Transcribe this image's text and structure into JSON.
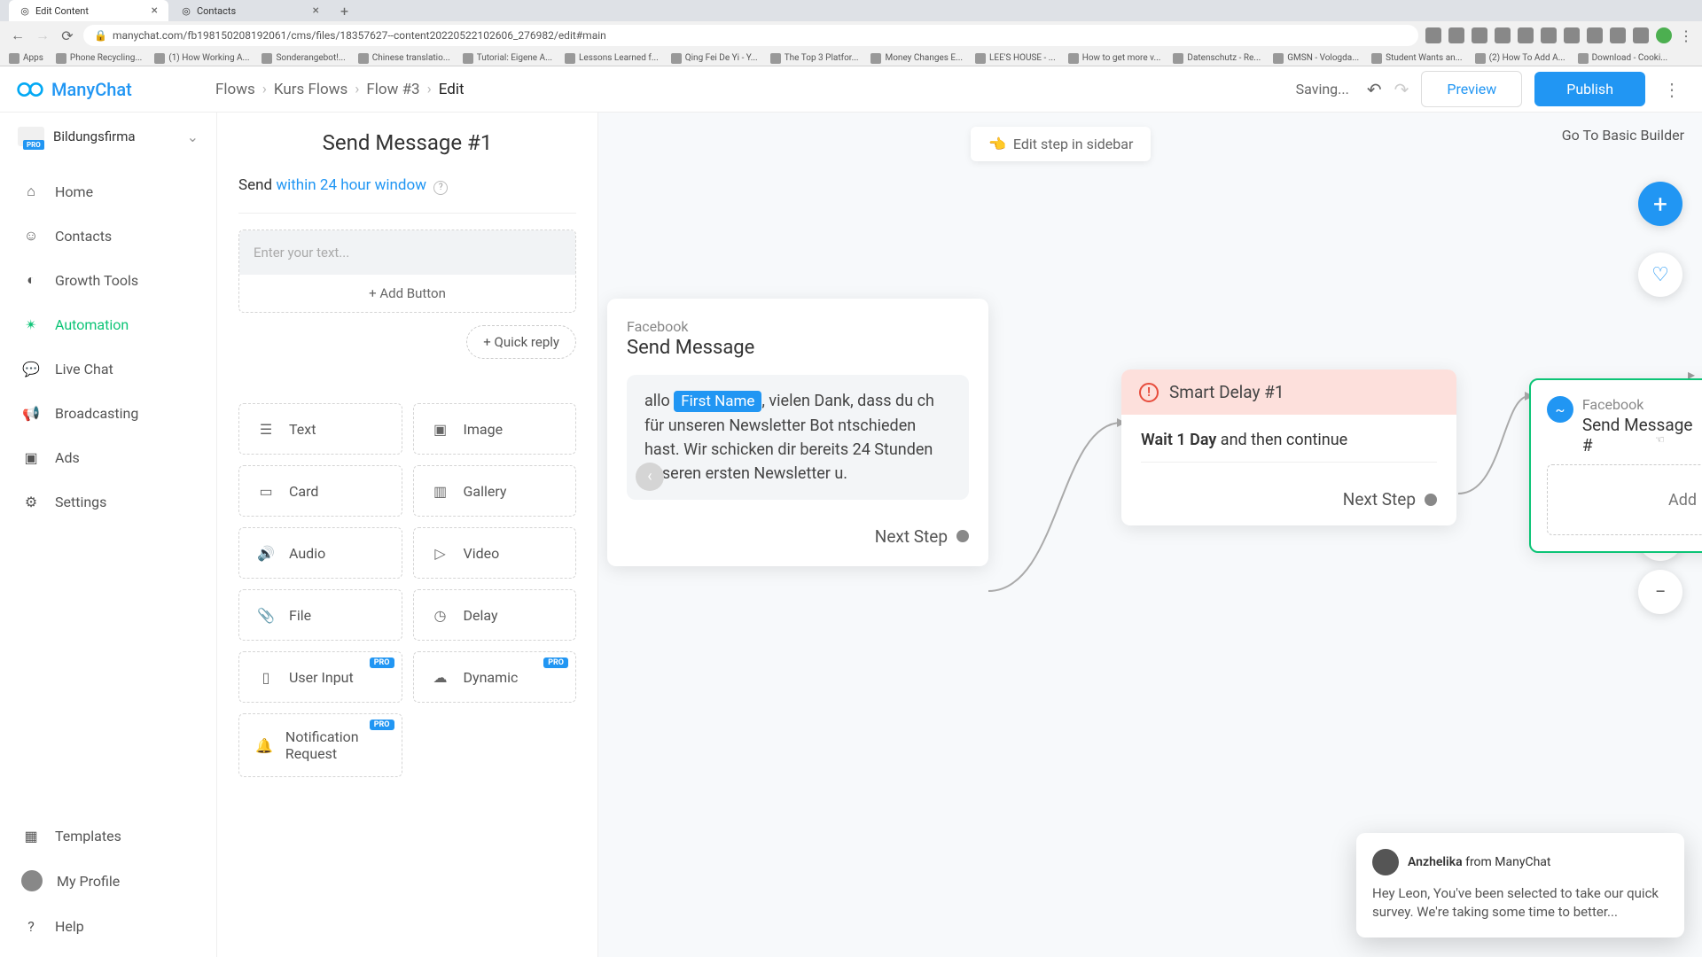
{
  "browser": {
    "tabs": [
      {
        "title": "Edit Content",
        "active": true
      },
      {
        "title": "Contacts",
        "active": false
      }
    ],
    "url": "manychat.com/fb198150208192061/cms/files/18357627--content20220522102606_276982/edit#main",
    "bookmarks": [
      "Apps",
      "Phone Recycling...",
      "(1) How Working A...",
      "Sonderangebot!...",
      "Chinese translatio...",
      "Tutorial: Eigene A...",
      "Lessons Learned f...",
      "Qing Fei De Yi - Y...",
      "The Top 3 Platfor...",
      "Money Changes E...",
      "LEE'S HOUSE - ...",
      "How to get more v...",
      "Datenschutz - Re...",
      "GMSN - Vologda...",
      "Student Wants an...",
      "(2) How To Add A...",
      "Download - Cooki..."
    ]
  },
  "header": {
    "logo": "ManyChat",
    "breadcrumbs": [
      "Flows",
      "Kurs Flows",
      "Flow #3",
      "Edit"
    ],
    "saving": "Saving...",
    "preview": "Preview",
    "publish": "Publish"
  },
  "org": {
    "name": "Bildungsfirma",
    "badge": "PRO"
  },
  "nav": {
    "items": [
      "Home",
      "Contacts",
      "Growth Tools",
      "Automation",
      "Live Chat",
      "Broadcasting",
      "Ads",
      "Settings"
    ],
    "active": 3,
    "bottom": [
      "Templates",
      "My Profile",
      "Help"
    ]
  },
  "editor": {
    "title": "Send Message #1",
    "send_prefix": "Send ",
    "send_link": "within 24 hour window",
    "placeholder": "Enter your text...",
    "add_button": "+ Add Button",
    "quick_reply": "+ Quick reply",
    "content_types": [
      "Text",
      "Image",
      "Card",
      "Gallery",
      "Audio",
      "Video",
      "File",
      "Delay",
      "User Input",
      "Dynamic",
      "Notification Request"
    ],
    "pro_indices": [
      8,
      9,
      10
    ],
    "pro_label": "PRO"
  },
  "canvas": {
    "edit_sidebar": "Edit step in sidebar",
    "basic_builder": "Go To Basic Builder",
    "node1": {
      "platform": "Facebook",
      "title": "Send Message",
      "msg_pre": "allo ",
      "msg_chip": "First Name",
      "msg_post": ", vielen Dank, dass du ch für unseren Newsletter Bot ntschieden hast. Wir schicken dir bereits 24 Stunden unseren ersten Newsletter u.",
      "next": "Next Step"
    },
    "node2": {
      "title": "Smart Delay #1",
      "wait_bold": "Wait 1 Day",
      "wait_rest": " and then continue",
      "next": "Next Step"
    },
    "node3": {
      "platform": "Facebook",
      "title": "Send Message #",
      "add": "Add"
    }
  },
  "chat": {
    "name": "Anzhelika",
    "from": " from ManyChat",
    "body": "Hey Leon,  You've been selected to take our quick survey. We're taking some time to better..."
  }
}
